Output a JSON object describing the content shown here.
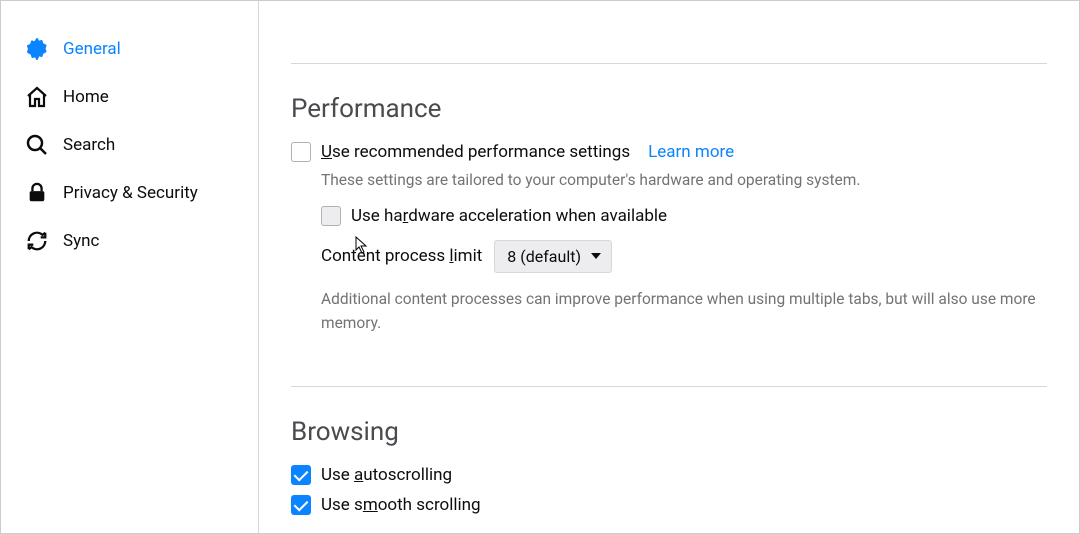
{
  "sidebar": {
    "items": [
      {
        "label": "General"
      },
      {
        "label": "Home"
      },
      {
        "label": "Search"
      },
      {
        "label": "Privacy & Security"
      },
      {
        "label": "Sync"
      }
    ]
  },
  "performance": {
    "title": "Performance",
    "use_recommended_label_pre": "U",
    "use_recommended_label_rest": "se recommended performance settings",
    "learn_more": "Learn more",
    "tailored_hint": "These settings are tailored to your computer's hardware and operating system.",
    "hw_accel_pre": "Use ha",
    "hw_accel_accel": "r",
    "hw_accel_post": "dware acceleration when available",
    "cp_limit_pre": "Content process ",
    "cp_limit_accel": "l",
    "cp_limit_post": "imit",
    "cp_limit_value": "8 (default)",
    "cp_hint": "Additional content processes can improve performance when using multiple tabs, but will also use more memory."
  },
  "browsing": {
    "title": "Browsing",
    "autoscroll_pre": "Use ",
    "autoscroll_accel": "a",
    "autoscroll_post": "utoscrolling",
    "smooth_pre": "Use s",
    "smooth_accel": "m",
    "smooth_post": "ooth scrolling"
  }
}
